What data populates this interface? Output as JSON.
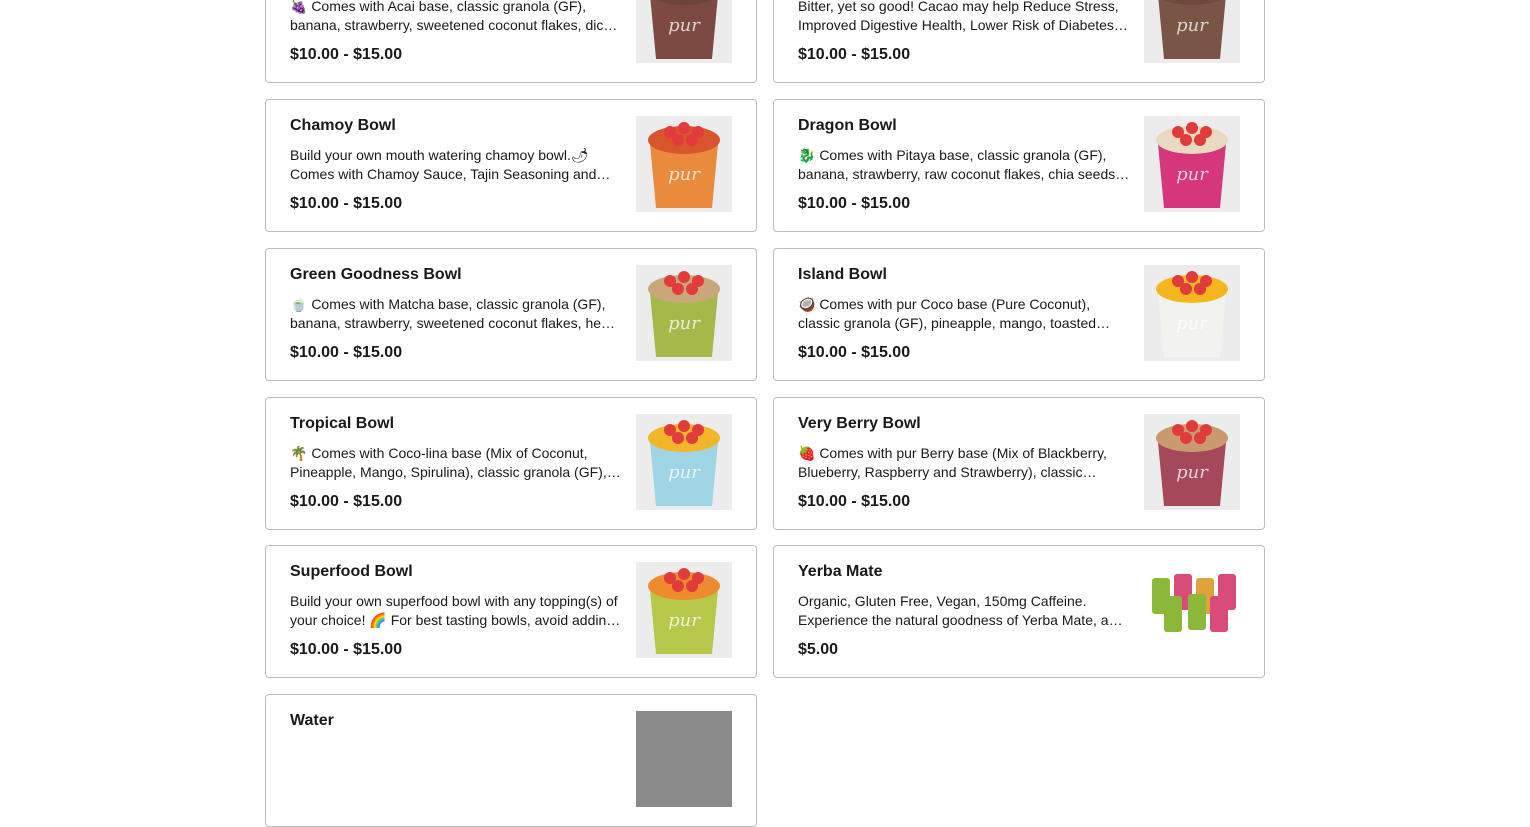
{
  "menu": {
    "items": [
      {
        "id": "acai",
        "name": "",
        "description": "🍇 Comes with Acai base, classic granola (GF), banana, strawberry, sweetened coconut flakes, diced mango, hemp seeds",
        "price": "$10.00 - $15.00",
        "image": "acai-bowl",
        "base_color": "#7d4a43",
        "top_color": "#6b4636"
      },
      {
        "id": "cacao",
        "name": "",
        "description": "Bitter, yet so good! Cacao may help Reduce Stress, Improved Digestive Health, Lower Risk of Diabetes and more",
        "price": "$10.00 - $15.00",
        "image": "cacao-bowl",
        "base_color": "#7a5546",
        "top_color": "#6e4a3c"
      },
      {
        "id": "chamoy",
        "name": "Chamoy Bowl",
        "description": "Build your own mouth watering chamoy bowl.🌶 Comes with Chamoy Sauce, Tajin Seasoning and fresh mango",
        "price": "$10.00 - $15.00",
        "image": "chamoy-bowl",
        "base_color": "#e98a3c",
        "top_color": "#d9552e"
      },
      {
        "id": "dragon",
        "name": "Dragon Bowl",
        "description": "🐉 Comes with Pitaya base, classic granola (GF), banana, strawberry, raw coconut flakes, chia seeds, hemp seeds",
        "price": "$10.00 - $15.00",
        "image": "dragon-bowl",
        "base_color": "#d6367a",
        "top_color": "#e8d9c0"
      },
      {
        "id": "green",
        "name": "Green Goodness Bowl",
        "description": "🍵 Comes with Matcha base, classic granola (GF), banana, strawberry, sweetened coconut flakes, hemp seeds",
        "price": "$10.00 - $15.00",
        "image": "green-bowl",
        "base_color": "#a7b84a",
        "top_color": "#c9a77a"
      },
      {
        "id": "island",
        "name": "Island Bowl",
        "description": "🥥 Comes with pur Coco base (Pure Coconut), classic granola (GF), pineapple, mango, toasted coconut flakes",
        "price": "$10.00 - $15.00",
        "image": "island-bowl",
        "base_color": "#f2f2ee",
        "top_color": "#f5b51e"
      },
      {
        "id": "tropical",
        "name": "Tropical Bowl",
        "description": "🌴 Comes with Coco-lina base (Mix of Coconut, Pineapple, Mango, Spirulina), classic granola (GF), mango, pineapple",
        "price": "$10.00 - $15.00",
        "image": "tropical-bowl",
        "base_color": "#9fd4e4",
        "top_color": "#f3b52a"
      },
      {
        "id": "berry",
        "name": "Very Berry Bowl",
        "description": "🍓 Comes with pur Berry base (Mix of Blackberry, Blueberry, Raspberry and Strawberry), classic granola (GF), berries",
        "price": "$10.00 - $15.00",
        "image": "berry-bowl",
        "base_color": "#a4485a",
        "top_color": "#c99a6e"
      },
      {
        "id": "superfood",
        "name": "Superfood Bowl",
        "description": "Build your own superfood bowl with any topping(s) of your choice! 🌈 For best tasting bowls, avoid adding too many toppings",
        "price": "$10.00 - $15.00",
        "image": "superfood-bowl",
        "base_color": "#b7c74a",
        "top_color": "#ef8a2e"
      },
      {
        "id": "yerba",
        "name": "Yerba Mate",
        "description": "Organic, Gluten Free, Vegan, 150mg Caffeine. Experience the natural goodness of Yerba Mate, a South American herbal tea",
        "price": "$5.00",
        "image": "yerba-mate-cans",
        "base_color": "#d84b7a",
        "top_color": "#8cb83a"
      },
      {
        "id": "water",
        "name": "Water",
        "description": "",
        "price": "",
        "image": "water-bottle",
        "base_color": "#8a8a8a",
        "top_color": "#8a8a8a"
      }
    ]
  }
}
